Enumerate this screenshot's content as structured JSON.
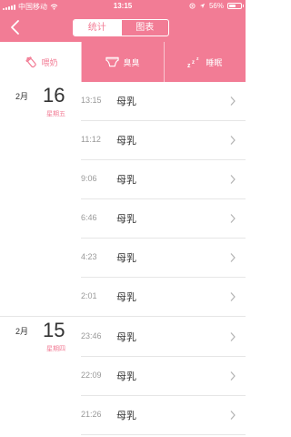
{
  "status_bar": {
    "carrier": "中国移动",
    "time": "13:15",
    "battery": "56%",
    "battery_level": 0.56
  },
  "header": {
    "segments": [
      {
        "label": "统计",
        "active": true
      },
      {
        "label": "图表",
        "active": false
      }
    ]
  },
  "tabs": [
    {
      "label": "喂奶",
      "icon": "bottle-icon",
      "selected": true
    },
    {
      "label": "臭臭",
      "icon": "diaper-icon",
      "selected": false
    },
    {
      "label": "睡眠",
      "icon": "sleep-zzz-icon",
      "selected": false
    }
  ],
  "groups": [
    {
      "month": "2月",
      "day": "16",
      "weekday": "星期五",
      "entries": [
        {
          "time": "13:15",
          "type": "母乳"
        },
        {
          "time": "11:12",
          "type": "母乳"
        },
        {
          "time": "9:06",
          "type": "母乳"
        },
        {
          "time": "6:46",
          "type": "母乳"
        },
        {
          "time": "4:23",
          "type": "母乳"
        },
        {
          "time": "2:01",
          "type": "母乳"
        }
      ]
    },
    {
      "month": "2月",
      "day": "15",
      "weekday": "星期四",
      "entries": [
        {
          "time": "23:46",
          "type": "母乳"
        },
        {
          "time": "22:09",
          "type": "母乳"
        },
        {
          "time": "21:26",
          "type": "母乳"
        }
      ]
    }
  ],
  "colors": {
    "accent": "#f27c95",
    "weekday": "#f27c95",
    "divider": "#e6e6e6"
  }
}
